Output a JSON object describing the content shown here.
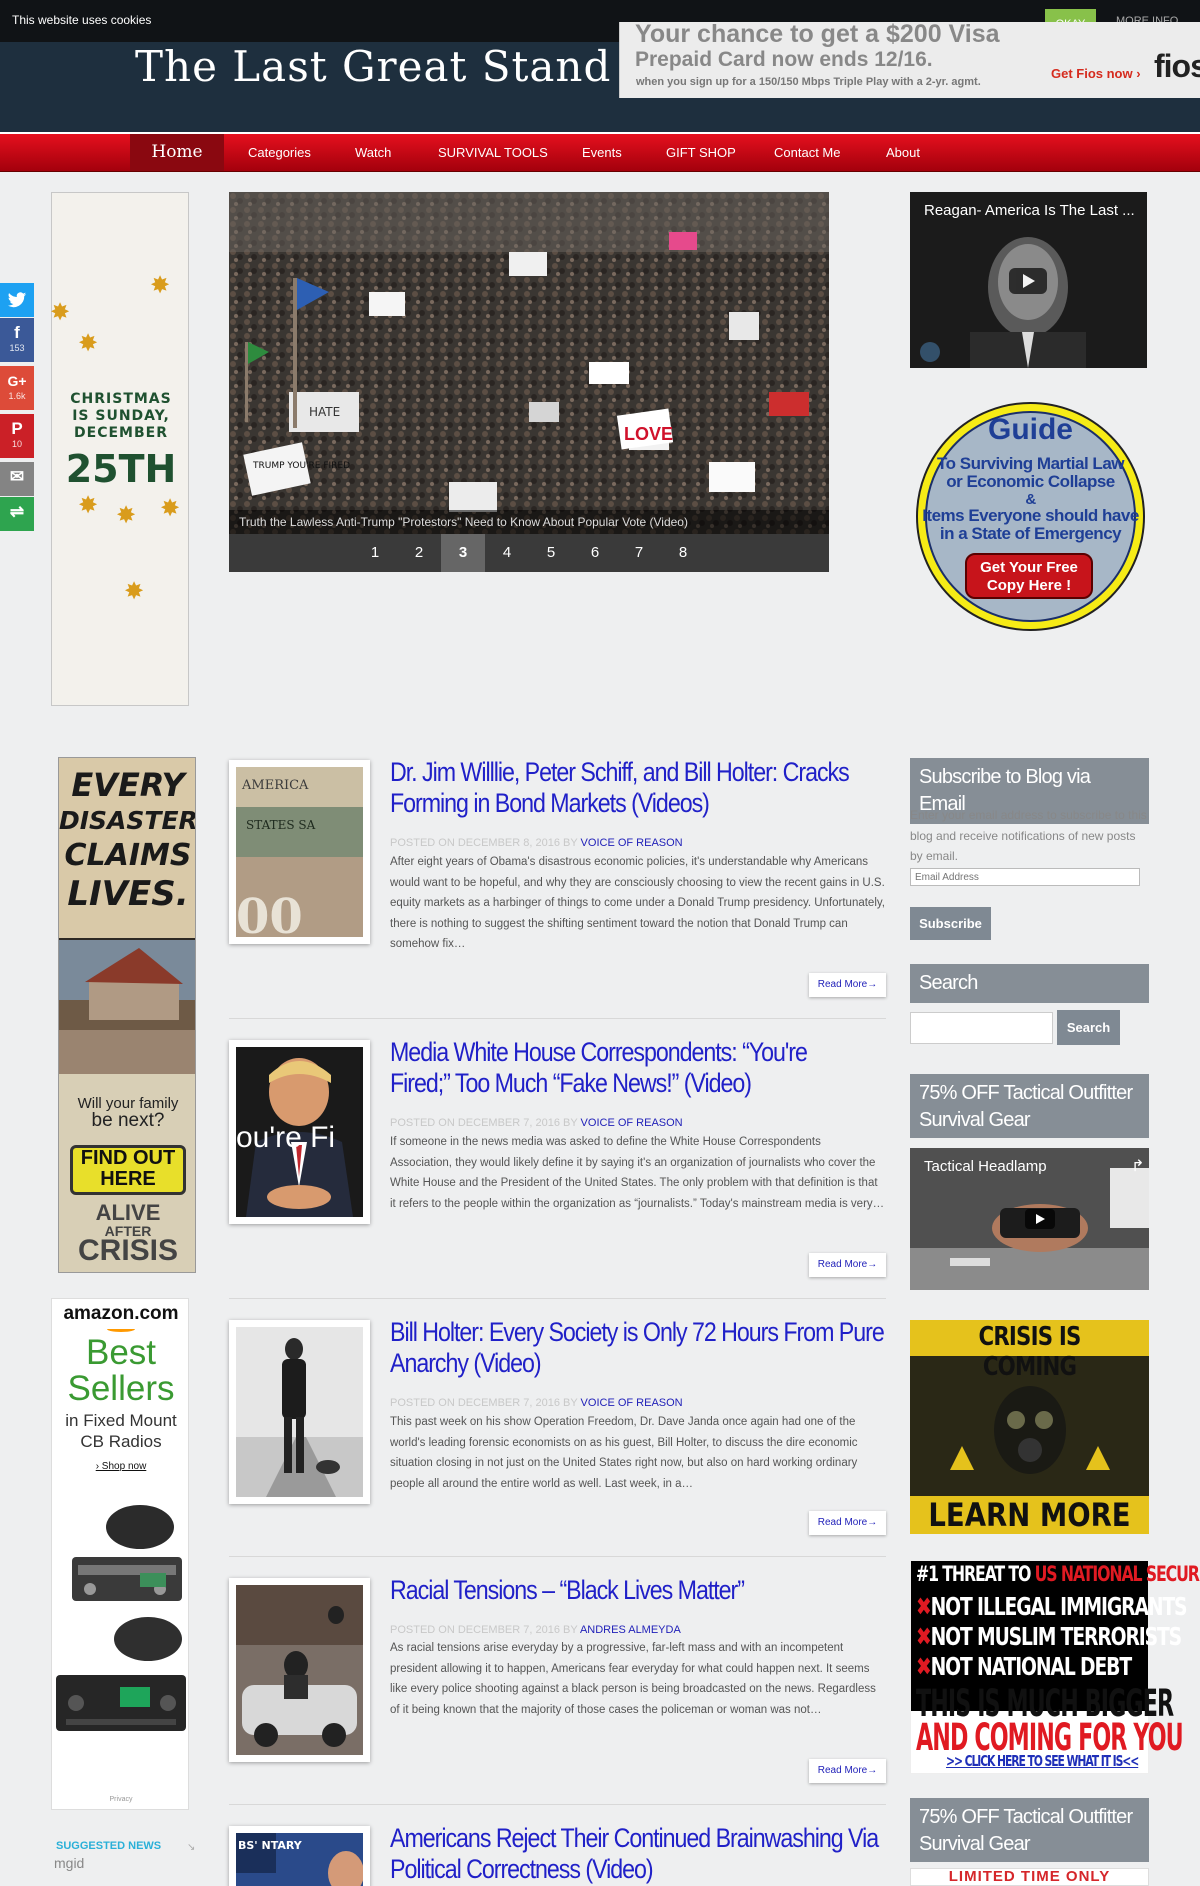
{
  "cookie": {
    "text": "This website uses cookies",
    "ok": "OKAY",
    "more": "MORE INFO"
  },
  "site": {
    "title": "The Last Great Stand"
  },
  "top_ad": {
    "line1": "Your chance to get a $200 Visa",
    "line2": "Prepaid Card now ends 12/16.",
    "line3": "when you sign up for a 150/150 Mbps Triple Play with a 2-yr. agmt.",
    "cta": "Get Fios now ›",
    "logo": "fios"
  },
  "nav": {
    "home": "Home",
    "items": [
      "Categories",
      "Watch",
      "SURVIVAL TOOLS",
      "Events",
      "GIFT SHOP",
      "Contact Me",
      "About"
    ]
  },
  "social": [
    {
      "icon": "twitter-icon",
      "glyph": "🐦",
      "count": "",
      "color": "#1da1f2"
    },
    {
      "icon": "facebook-icon",
      "glyph": "f",
      "count": "153",
      "color": "#3b5998"
    },
    {
      "icon": "google-plus-icon",
      "glyph": "G+",
      "count": "1.6k",
      "color": "#dd4b39"
    },
    {
      "icon": "pinterest-icon",
      "glyph": "P",
      "count": "10",
      "color": "#cb2027"
    },
    {
      "icon": "email-icon",
      "glyph": "✉",
      "count": "",
      "color": "#848484"
    },
    {
      "icon": "more-share-icon",
      "glyph": "⇌",
      "count": "",
      "color": "#2ea44f"
    }
  ],
  "xmas_ad": {
    "line1": "CHRISTMAS",
    "line2": "IS SUNDAY,",
    "line3": "DECEMBER",
    "day": "25TH"
  },
  "slider": {
    "caption": "Truth the Lawless Anti-Trump \"Protestors\" Need to Know About Popular Vote (Video)",
    "pages": [
      "1",
      "2",
      "3",
      "4",
      "5",
      "6",
      "7",
      "8"
    ],
    "active": "3",
    "sign_texts": [
      "LOVE",
      "HATE",
      "TRUMP YOU'RE FIRED"
    ]
  },
  "reagan_video": {
    "title": "Reagan- America Is The Last ..."
  },
  "guide_ad": {
    "title": "Guide",
    "l1": "To Surviving Martial Law",
    "l2": "or Economic Collapse",
    "l3": "&",
    "l4": "Items Everyone should have",
    "l5": "in a State of Emergency",
    "btn1": "Get Your Free",
    "btn2": "Copy Here !"
  },
  "disaster_ad": {
    "l1": "EVERY",
    "l2": "DISASTER",
    "l3": "CLAIMS",
    "l4": "LIVES.",
    "q1": "Will your family",
    "q2": "be next?",
    "btn1": "FIND OUT",
    "btn2": "HERE",
    "a1": "ALIVE",
    "a2": "AFTER",
    "a3": "CRISIS"
  },
  "amazon_ad": {
    "brand": "amazon.com",
    "l1": "Best",
    "l2": "Sellers",
    "l3": "in Fixed Mount",
    "l4": "CB Radios",
    "shop": "› Shop now",
    "privacy": "Privacy"
  },
  "suggested": {
    "label": "SUGGESTED NEWS",
    "brand": "mgid"
  },
  "articles": [
    {
      "title1": "Dr. Jim Willlie, Peter Schiff, and Bill Holter: Cracks",
      "title2": "Forming in Bond Markets (Videos)",
      "posted": "POSTED ON DECEMBER 8, 2016 BY",
      "author": "VOICE OF REASON",
      "excerpt": "After eight years of Obama's disastrous economic policies, it's understandable why Americans would want to be hopeful, and why they are consciously choosing to view the recent gains in U.S. equity markets as a harbinger of things to come under a Donald Trump presidency. Unfortunately, there is nothing to suggest the shifting sentiment toward the notion that Donald Trump can somehow fix…",
      "readmore": "Read More→"
    },
    {
      "title1": "Media White House Correspondents: “You're",
      "title2": "Fired;” Too Much “Fake News!” (Video)",
      "posted": "POSTED ON DECEMBER 7, 2016 BY",
      "author": "VOICE OF REASON",
      "excerpt": "If someone in the news media was asked to define the White House Correspondents Association, they would likely define it by saying it's an organization of journalists who cover the White House and the President of the United States. The only problem with that definition is that it refers to the people within the organization as “journalists.” Today's mainstream media is very…",
      "readmore": "Read More→",
      "thumb_text": "ou're Fi"
    },
    {
      "title1": "Bill Holter: Every Society is Only 72 Hours From Pure",
      "title2": "Anarchy (Video)",
      "posted": "POSTED ON DECEMBER 7, 2016 BY",
      "author": "VOICE OF REASON",
      "excerpt": "This past week on his show Operation Freedom, Dr. Dave Janda once again had one of the world's leading forensic economists on as his guest, Bill Holter, to discuss the dire economic situation closing in not just on the United States right now, but also on hard working ordinary people all around the entire world as well. Last week, in a…",
      "readmore": "Read More→"
    },
    {
      "title1": "Racial Tensions – “Black Lives Matter”",
      "title2": "",
      "posted": "POSTED ON DECEMBER 7, 2016 BY",
      "author": "ANDRES ALMEYDA",
      "excerpt": "As racial tensions arise everyday by a progressive, far-left mass and with an incompetent president allowing it to happen, Americans fear everyday for what could happen next. It seems like every police shooting against a black person is being broadcasted on the news. Regardless of it being known that the majority of those cases the policeman or woman was not…",
      "readmore": "Read More→"
    },
    {
      "title1": "Americans Reject Their Continued Brainwashing Via",
      "title2": "Political Correctness (Video)",
      "thumb_text": "BS' NTARY"
    }
  ],
  "sidebar": {
    "subscribe_title": "Subscribe to Blog via Email",
    "subscribe_text": "Enter your email address to subscribe to this blog and receive notifications of new posts by email.",
    "email_placeholder": "Email Address",
    "subscribe_btn": "Subscribe",
    "search_title": "Search",
    "search_btn": "Search",
    "tactical_title1": "75% OFF Tactical Outfitter",
    "tactical_title2": "Survival Gear",
    "video2_title": "Tactical Headlamp",
    "crisis_top": "CRISIS IS COMING",
    "crisis_bottom": "LEARN MORE",
    "threat_l1a": "#1 THREAT TO ",
    "threat_l1b": "US NATIONAL SECURITY",
    "threat_l2": "NOT ILLEGAL IMMIGRANTS",
    "threat_l3": "NOT MUSLIM TERRORISTS",
    "threat_l4": "NOT NATIONAL DEBT",
    "threat_l5": "THIS IS MUCH BIGGER",
    "threat_l6": "AND COMING FOR YOU",
    "threat_l7": ">> CLICK HERE TO SEE WHAT IT IS<<",
    "tactical2_title1": "75% OFF Tactical Outfitter",
    "tactical2_title2": "Survival Gear",
    "limited": "LIMITED TIME ONLY"
  }
}
